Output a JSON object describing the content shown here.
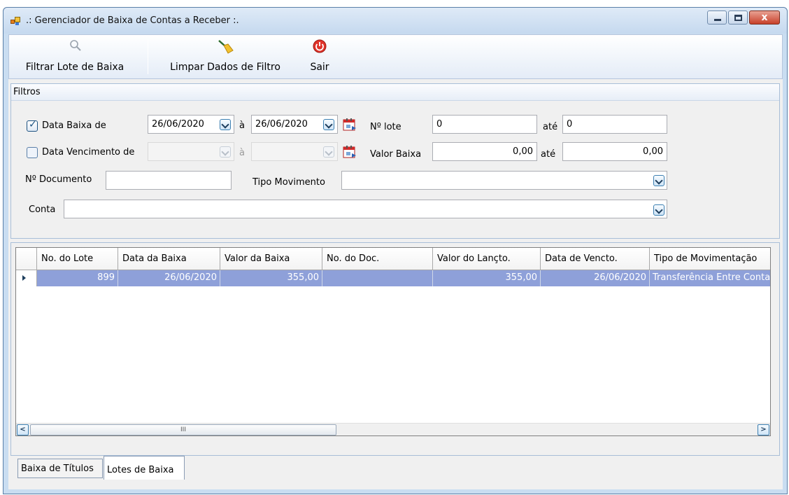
{
  "window": {
    "title": ".: Gerenciador de Baixa de Contas a Receber :.",
    "close_label": "x"
  },
  "toolbar": {
    "filter_label": "Filtrar Lote de Baixa",
    "clear_label": "Limpar Dados de Filtro",
    "exit_label": "Sair"
  },
  "filters": {
    "header": "Filtros",
    "data_baixa_label": "Data Baixa de",
    "data_baixa_from": "26/06/2020",
    "a_label_1": "à",
    "data_baixa_to": "26/06/2020",
    "lote_label": "Nº lote",
    "lote_from": "0",
    "ate_label_1": "até",
    "lote_to": "0",
    "data_venc_label": "Data Vencimento de",
    "a_label_2": "à",
    "valor_label": "Valor Baixa",
    "valor_from": "0,00",
    "ate_label_2": "até",
    "valor_to": "0,00",
    "documento_label": "Nº Documento",
    "documento_value": "",
    "tipo_label": "Tipo Movimento",
    "tipo_value": "",
    "conta_label": "Conta",
    "conta_value": ""
  },
  "grid": {
    "columns": [
      "No. do Lote",
      "Data da Baixa",
      "Valor da Baixa",
      "No. do Doc.",
      "Valor do Lançto.",
      "Data de Vencto.",
      "Tipo de Movimentação"
    ],
    "rows": [
      [
        "899",
        "26/06/2020",
        "355,00",
        "",
        "355,00",
        "26/06/2020",
        "Transferência Entre Contas"
      ]
    ],
    "scroll_thumb": "III"
  },
  "tabs": [
    "Baixa de Títulos",
    "Lotes de Baixa"
  ],
  "colors": {
    "selected_row": "#8ea0d9",
    "title_bar": "#c5d9ef",
    "close_button": "#c8412a"
  }
}
